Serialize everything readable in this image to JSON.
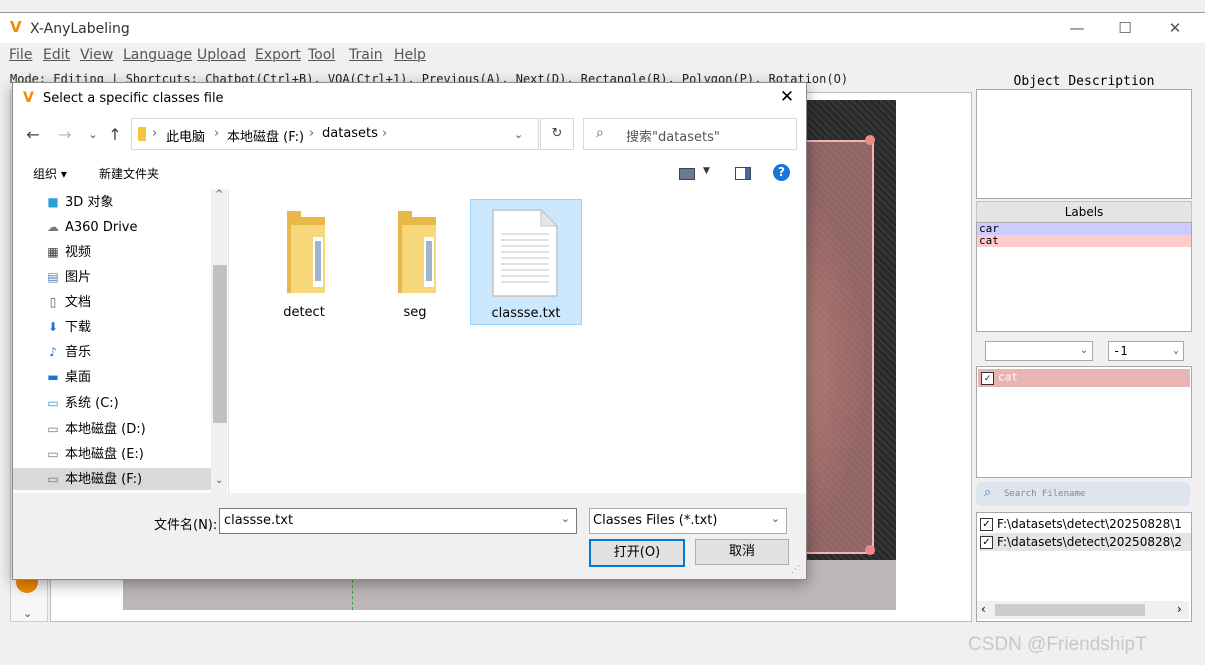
{
  "app": {
    "title": "X-AnyLabeling",
    "window_controls": {
      "minimize": "—",
      "maximize": "☐",
      "close": "✕"
    }
  },
  "menu": [
    {
      "label": "File"
    },
    {
      "label": "Edit"
    },
    {
      "label": "View"
    },
    {
      "label": "Language"
    },
    {
      "label": "Upload"
    },
    {
      "label": "Export"
    },
    {
      "label": "Tool"
    },
    {
      "label": "Train"
    },
    {
      "label": "Help"
    }
  ],
  "status_line": "Mode: Editing | Shortcuts: Chatbot(Ctrl+B), VQA(Ctrl+1), Previous(A), Next(D), Rectangle(R), Polygon(P), Rotation(O)",
  "right_panel": {
    "object_description_title": "Object Description",
    "labels_header": "Labels",
    "labels": [
      {
        "text": "car",
        "color": "#ccccff"
      },
      {
        "text": "cat",
        "color": "#ffcccc"
      }
    ],
    "group_combo_value": "",
    "group_id_combo_value": "-1",
    "shapes": [
      {
        "label": "cat",
        "checked": true,
        "color": "#e8b4b4"
      }
    ],
    "search_placeholder": "Search Filename",
    "files": [
      {
        "path": "F:\\datasets\\detect\\20250828\\1",
        "checked": true
      },
      {
        "path": "F:\\datasets\\detect\\20250828\\2",
        "checked": true
      }
    ]
  },
  "dialog": {
    "title": "Select a specific classes file",
    "close": "✕",
    "address": {
      "crumbs": [
        "此电脑",
        "本地磁盘 (F:)",
        "datasets"
      ],
      "search_placeholder": "搜索\"datasets\""
    },
    "toolbar": {
      "organize": "组织 ▾",
      "new_folder": "新建文件夹",
      "help": "?"
    },
    "nav_items": [
      {
        "label": "3D 对象",
        "icon": "cube-icon"
      },
      {
        "label": "A360 Drive",
        "icon": "cloud-drive-icon"
      },
      {
        "label": "视频",
        "icon": "video-icon"
      },
      {
        "label": "图片",
        "icon": "picture-icon"
      },
      {
        "label": "文档",
        "icon": "document-icon"
      },
      {
        "label": "下载",
        "icon": "download-icon"
      },
      {
        "label": "音乐",
        "icon": "music-icon"
      },
      {
        "label": "桌面",
        "icon": "desktop-icon"
      },
      {
        "label": "系统 (C:)",
        "icon": "system-drive-icon"
      },
      {
        "label": "本地磁盘 (D:)",
        "icon": "drive-icon"
      },
      {
        "label": "本地磁盘 (E:)",
        "icon": "drive-icon"
      },
      {
        "label": "本地磁盘 (F:)",
        "icon": "drive-icon",
        "selected": true
      }
    ],
    "files": [
      {
        "name": "detect",
        "type": "folder"
      },
      {
        "name": "seg",
        "type": "folder"
      },
      {
        "name": "classse.txt",
        "type": "file",
        "selected": true
      }
    ],
    "filename_label": "文件名(N):",
    "filename_value": "classse.txt",
    "filetype_value": "Classes Files (*.txt)",
    "open_label": "打开(O)",
    "cancel_label": "取消"
  },
  "watermark": "CSDN @FriendshipT"
}
